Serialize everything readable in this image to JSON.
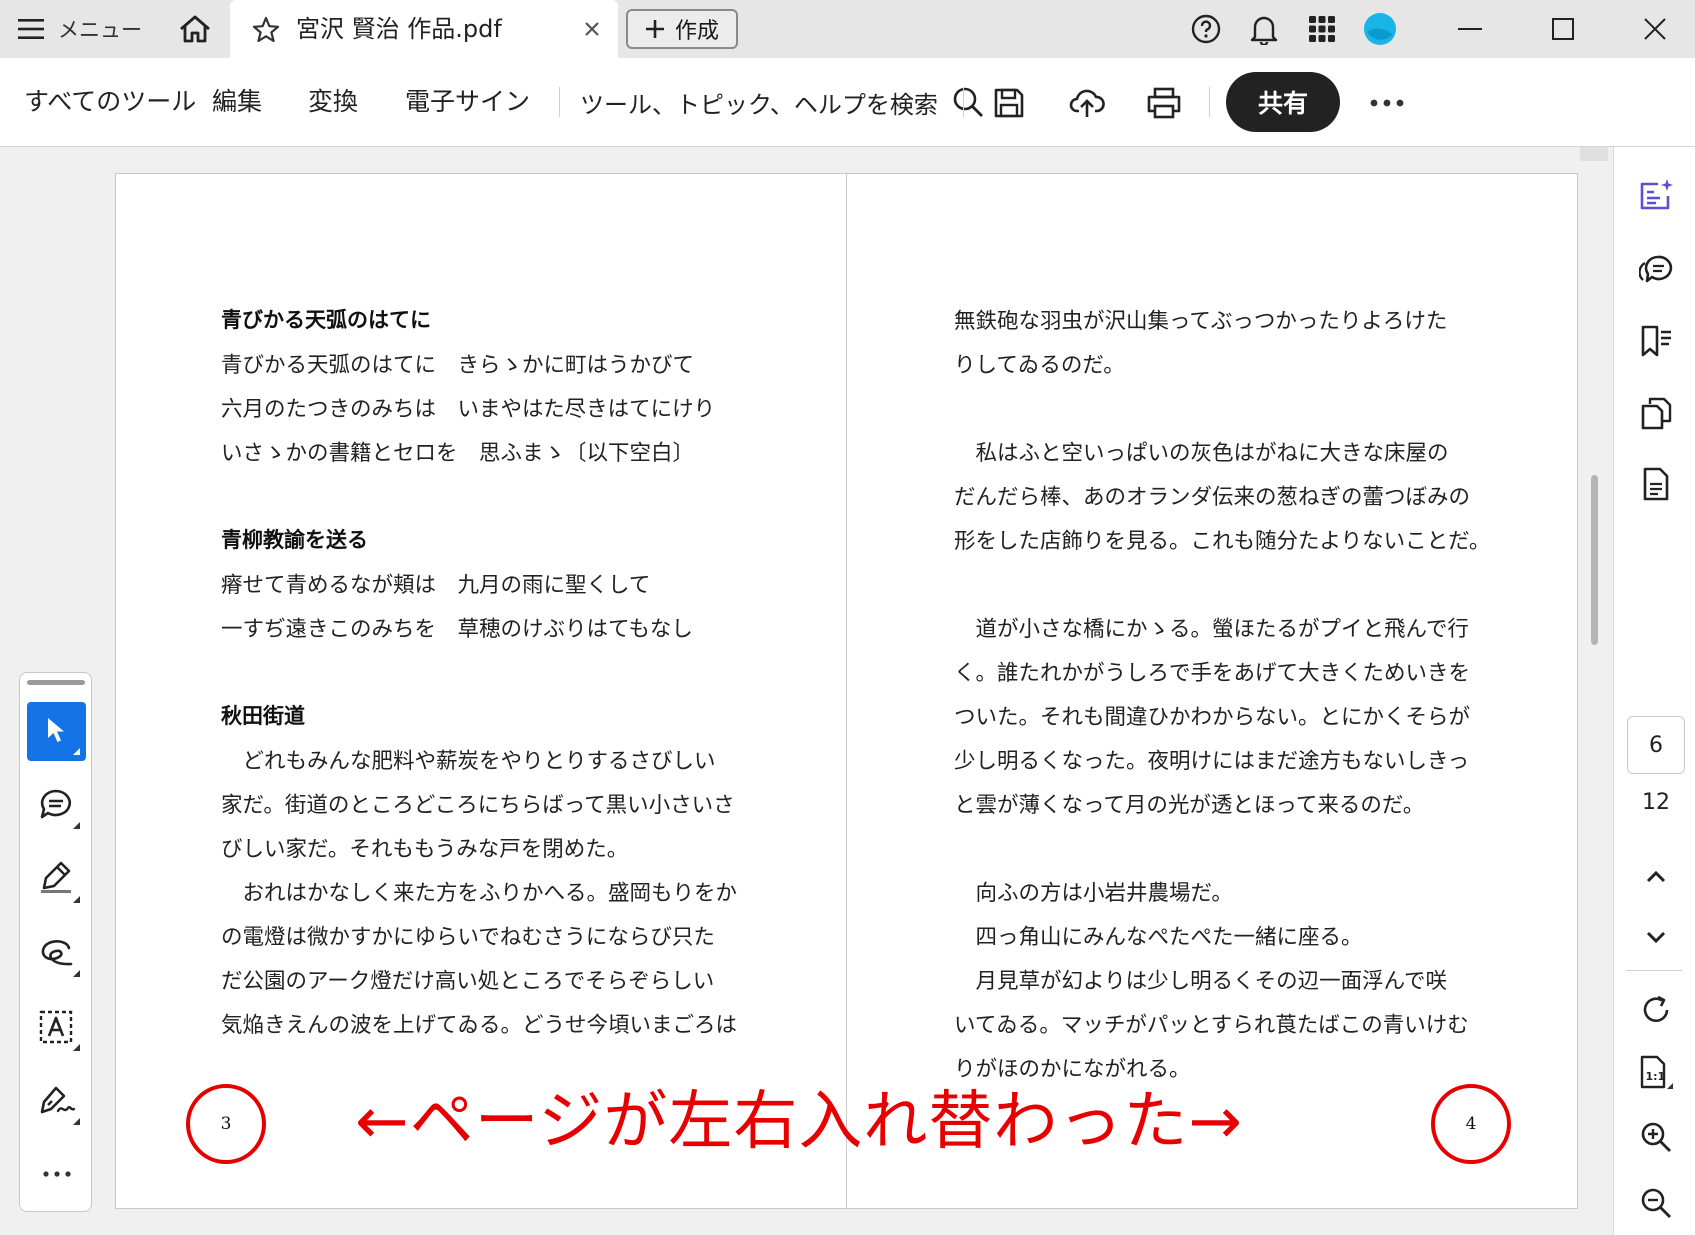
{
  "titlebar": {
    "menu_label": "メニュー",
    "tab_title": "宮沢 賢治 作品.pdf",
    "create_label": "作成"
  },
  "toolbar": {
    "all_tools": "すべてのツール",
    "edit": "編集",
    "convert": "変換",
    "esign": "電子サイン",
    "search": "ツール、トピック、ヘルプを検索",
    "share": "共有"
  },
  "left_page": {
    "lines": [
      {
        "text": "青びかる天弧のはてに",
        "bold": true
      },
      {
        "text": "青びかる天弧のはてに　きらゝかに町はうかびて",
        "bold": false
      },
      {
        "text": "六月のたつきのみちは　いまやはた尽きはてにけり",
        "bold": false
      },
      {
        "text": "いさゝかの書籍とセロを　思ふまゝ〔以下空白〕",
        "bold": false
      },
      {
        "text": "",
        "bold": false
      },
      {
        "text": "青柳教諭を送る",
        "bold": true
      },
      {
        "text": "瘠せて青めるなが頬は　九月の雨に聖くして",
        "bold": false
      },
      {
        "text": "一すぢ遠きこのみちを　草穂のけぶりはてもなし",
        "bold": false
      },
      {
        "text": "",
        "bold": false
      },
      {
        "text": "秋田街道",
        "bold": true
      },
      {
        "text": "　どれもみんな肥料や薪炭をやりとりするさびしい",
        "bold": false
      },
      {
        "text": "家だ。街道のところどころにちらばって黒い小さいさ",
        "bold": false
      },
      {
        "text": "びしい家だ。それももうみな戸を閉めた。",
        "bold": false
      },
      {
        "text": "　おれはかなしく来た方をふりかへる。盛岡もりをか",
        "bold": false
      },
      {
        "text": "の電燈は微かすかにゆらいでねむさうにならび只た",
        "bold": false
      },
      {
        "text": "だ公園のアーク燈だけ高い処ところでそらぞらしい",
        "bold": false
      },
      {
        "text": "気焔きえんの波を上げてゐる。どうせ今頃いまごろは",
        "bold": false
      }
    ],
    "page_number": "3"
  },
  "right_page": {
    "lines": [
      "無鉄砲な羽虫が沢山集ってぶっつかったりよろけた",
      "りしてゐるのだ。",
      "",
      "　私はふと空いっぱいの灰色はがねに大きな床屋の",
      "だんだら棒、あのオランダ伝来の葱ねぎの蕾つぼみの",
      "形をした店飾りを見る。これも随分たよりないことだ。",
      "",
      "　道が小さな橋にかゝる。螢ほたるがプイと飛んで行",
      "く。誰たれかがうしろで手をあげて大きくためいきを",
      "ついた。それも間違ひかわからない。とにかくそらが",
      "少し明るくなった。夜明けにはまだ途方もないしきっ",
      "と雲が薄くなって月の光が透とほって来るのだ。",
      "",
      "　向ふの方は小岩井農場だ。",
      "　四っ角山にみんなぺたぺた一緒に座る。",
      "　月見草が幻よりは少し明るくその辺一面浮んで咲",
      "いてゐる。マッチがパッとすられ莨たばこの青いけむ",
      "りがほのかにながれる。"
    ],
    "page_number": "4"
  },
  "annotation": {
    "text": "←ページが左右入れ替わった→",
    "color": "#e60000"
  },
  "page_nav": {
    "current": "6",
    "total": "12"
  },
  "colors": {
    "accent": "#1473e6",
    "share_bg": "#222222",
    "ai_icon": "#5b4fd6"
  }
}
